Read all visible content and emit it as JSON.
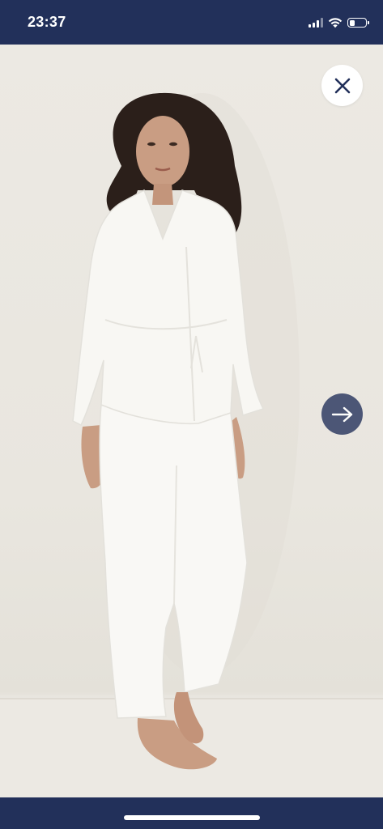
{
  "status_bar": {
    "time": "23:37",
    "icons": [
      "cellular-signal-icon",
      "wifi-icon",
      "battery-icon"
    ],
    "battery_level": 0.35
  },
  "gallery": {
    "image_subject": "product-photo",
    "close_icon": "close-icon",
    "next_icon": "arrow-right-icon"
  },
  "colors": {
    "bar_background": "#22305a",
    "photo_background": "#ece9e3",
    "next_button": "#3f4a6e",
    "close_button": "#ffffff"
  }
}
